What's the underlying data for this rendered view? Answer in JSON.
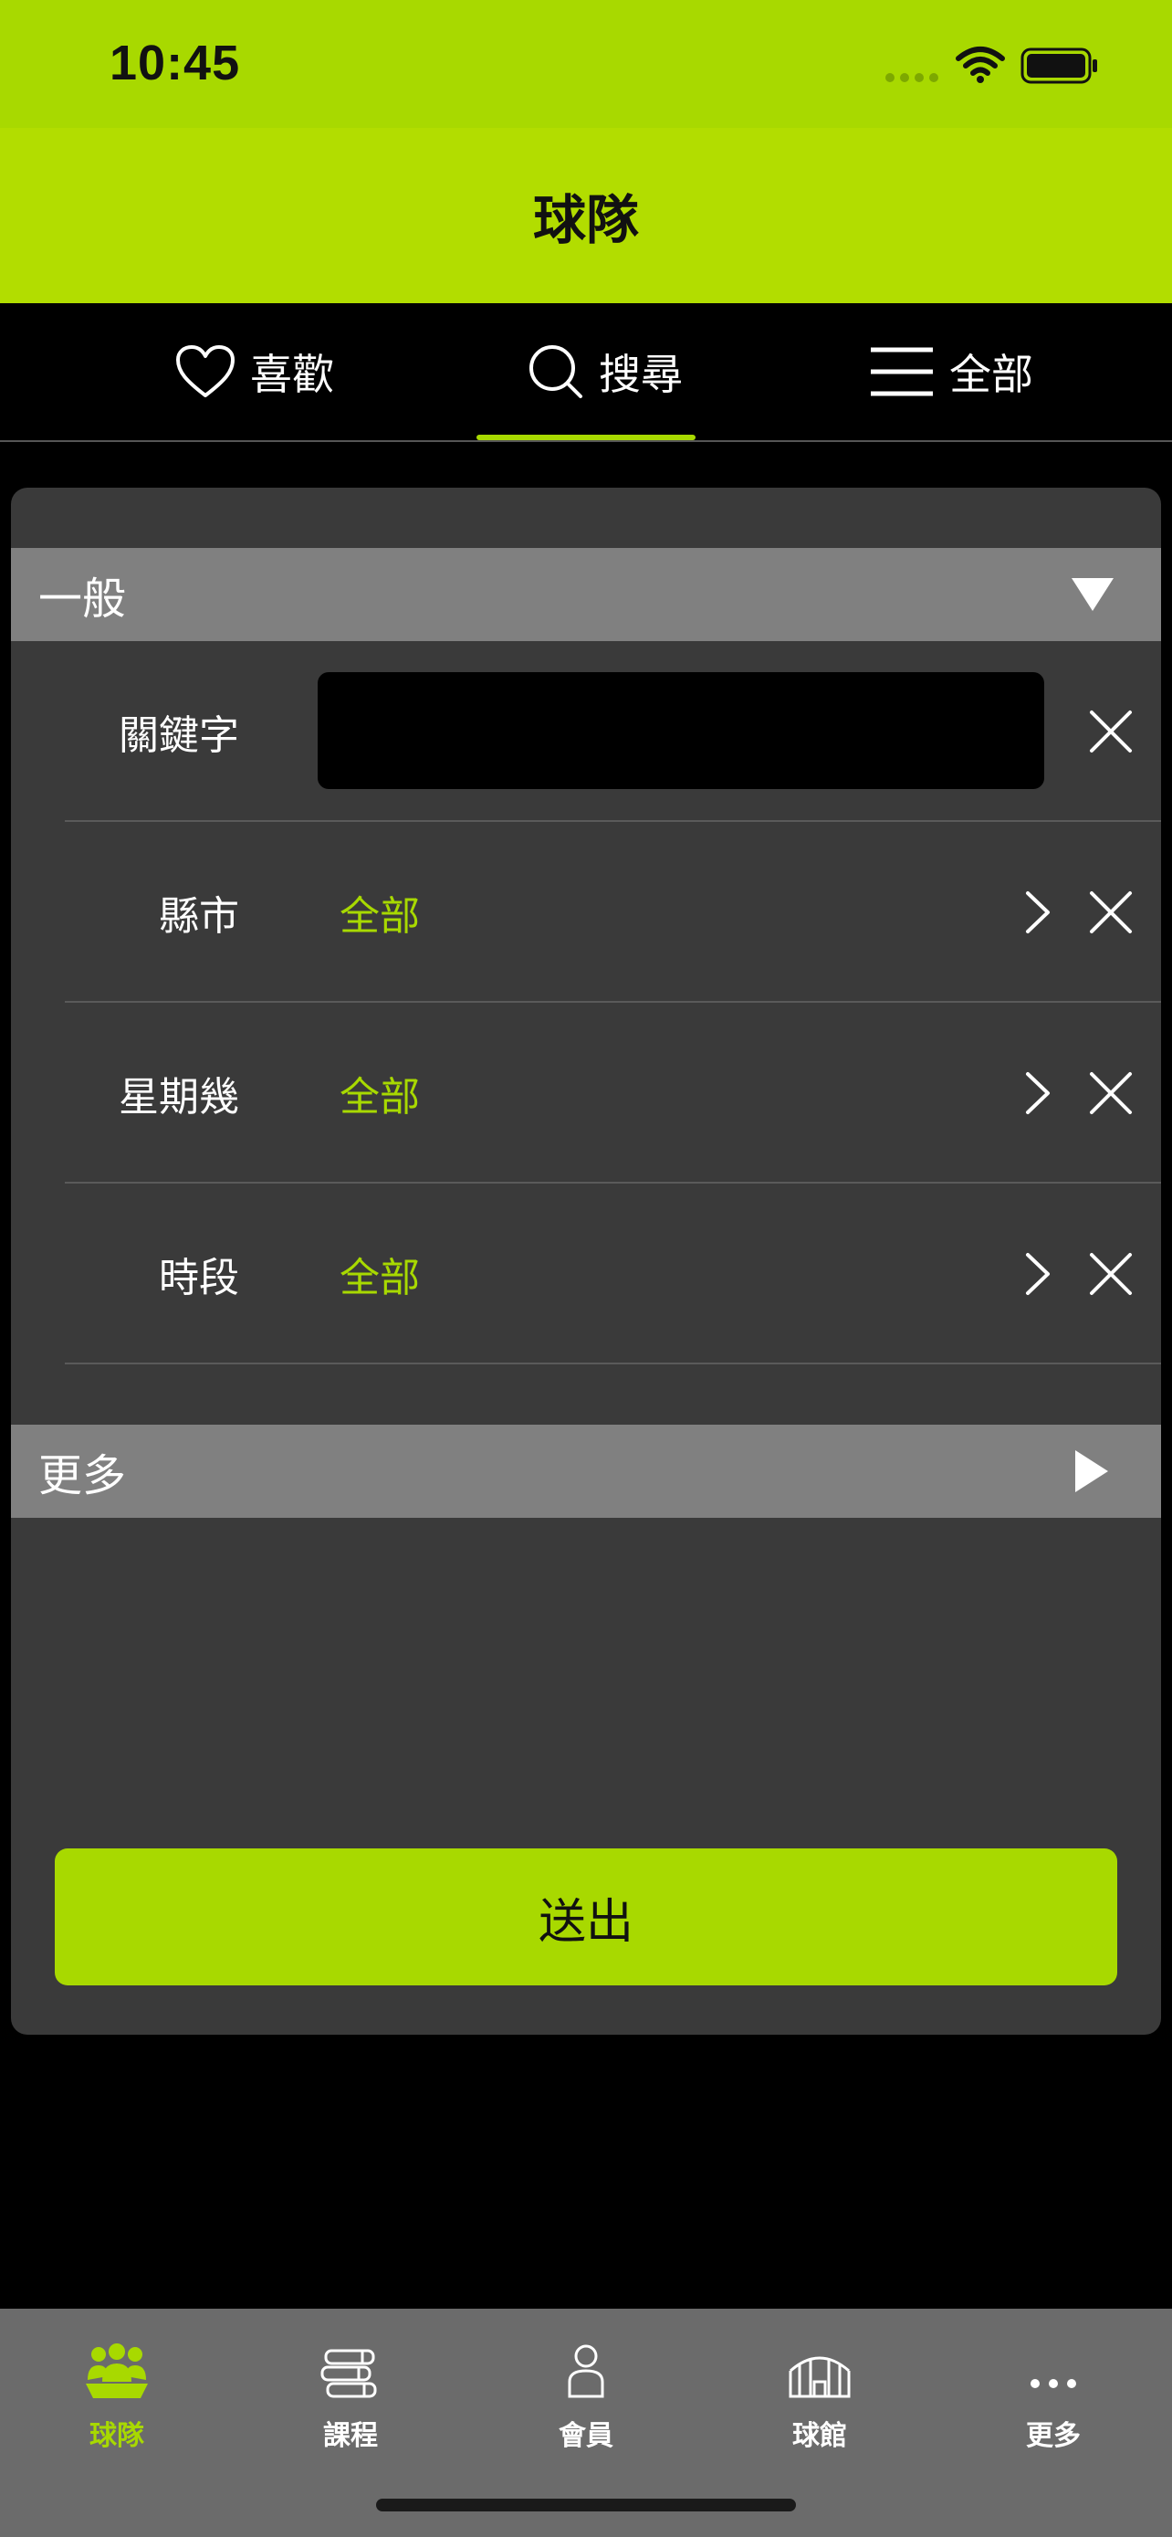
{
  "status_bar": {
    "time": "10:45"
  },
  "header": {
    "title": "球隊"
  },
  "top_tabs": [
    {
      "label": "喜歡",
      "icon": "heart-icon"
    },
    {
      "label": "搜尋",
      "icon": "search-icon",
      "active": true
    },
    {
      "label": "全部",
      "icon": "list-icon"
    }
  ],
  "sections": {
    "general": {
      "title": "一般",
      "expanded": true
    },
    "more": {
      "title": "更多",
      "expanded": false
    }
  },
  "keyword": {
    "label": "關鍵字",
    "value": "",
    "placeholder": ""
  },
  "filters": [
    {
      "label": "縣市",
      "value": "全部"
    },
    {
      "label": "星期幾",
      "value": "全部"
    },
    {
      "label": "時段",
      "value": "全部"
    }
  ],
  "submit_label": "送出",
  "bottom_tabs": [
    {
      "label": "球隊",
      "icon": "team-icon",
      "active": true
    },
    {
      "label": "課程",
      "icon": "books-icon"
    },
    {
      "label": "會員",
      "icon": "person-icon"
    },
    {
      "label": "球館",
      "icon": "arena-icon"
    },
    {
      "label": "更多",
      "icon": "more-dots-icon"
    }
  ],
  "colors": {
    "accent": "#a8d900",
    "header": "#b2dd00",
    "panel": "#3a3a3a",
    "section": "#808080",
    "tabbar": "#6b6b6b"
  }
}
